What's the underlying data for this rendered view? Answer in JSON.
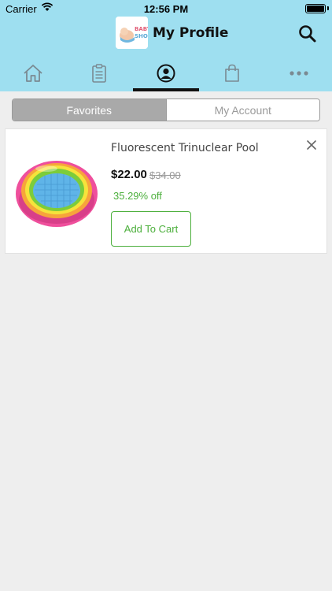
{
  "status": {
    "carrier": "Carrier",
    "time": "12:56 PM"
  },
  "header": {
    "title": "My Profile",
    "logo_text": "BABY SHOP"
  },
  "tabs": [
    {
      "name": "home",
      "icon": "home-icon",
      "active": false
    },
    {
      "name": "orders",
      "icon": "clipboard-icon",
      "active": false
    },
    {
      "name": "profile",
      "icon": "user-icon",
      "active": true
    },
    {
      "name": "cart",
      "icon": "shopping-bag-icon",
      "active": false
    },
    {
      "name": "more",
      "icon": "more-icon",
      "active": false
    }
  ],
  "segments": {
    "favorites": "Favorites",
    "account": "My Account"
  },
  "favorite_item": {
    "name": "Fluorescent Trinuclear Pool",
    "price": "$22.00",
    "old_price": "$34.00",
    "discount": "35.29% off",
    "add_to_cart": "Add To Cart"
  },
  "colors": {
    "header_bg": "#9edff0",
    "accent_green": "#4caf3c",
    "segment_active": "#a9a9a9",
    "page_bg": "#eeeeee"
  }
}
